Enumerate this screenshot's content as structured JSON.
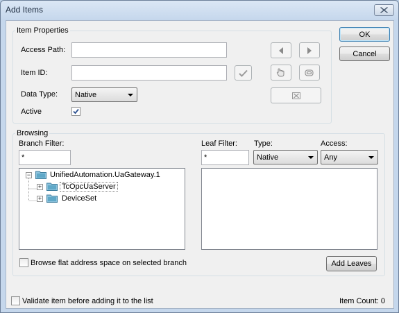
{
  "window": {
    "title": "Add Items"
  },
  "item_properties": {
    "group_label": "Item Properties",
    "access_path": {
      "label": "Access Path:",
      "value": ""
    },
    "item_id": {
      "label": "Item ID:",
      "value": ""
    },
    "data_type": {
      "label": "Data Type:",
      "selected": "Native"
    },
    "active": {
      "label": "Active",
      "checked": true
    }
  },
  "buttons": {
    "ok": "OK",
    "cancel": "Cancel",
    "add_leaves": "Add Leaves"
  },
  "browsing": {
    "group_label": "Browsing",
    "branch_filter": {
      "label": "Branch Filter:",
      "value": "*"
    },
    "leaf_filter": {
      "label": "Leaf Filter:",
      "value": "*"
    },
    "type": {
      "label": "Type:",
      "selected": "Native"
    },
    "access": {
      "label": "Access:",
      "selected": "Any"
    },
    "tree": {
      "root": "UnifiedAutomation.UaGateway.1",
      "children": [
        "TcOpcUaServer",
        "DeviceSet"
      ]
    },
    "flat_browse": {
      "label": "Browse flat address space on selected branch",
      "checked": false
    }
  },
  "footer": {
    "validate": {
      "label": "Validate item before adding it to the list",
      "checked": false
    },
    "item_count": "Item Count: 0"
  },
  "colors": {
    "accent": "#1b2a3e",
    "folder": "#5fa8c8",
    "selection_outline": "#7a7a7a"
  }
}
